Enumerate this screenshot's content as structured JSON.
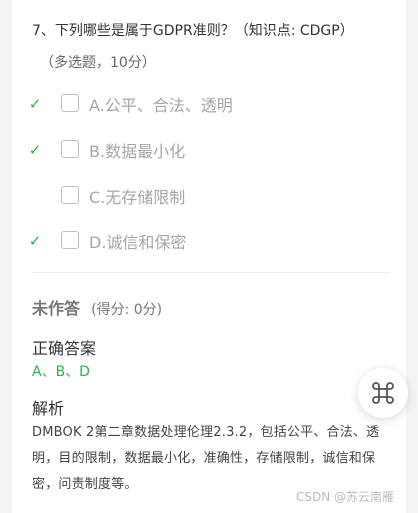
{
  "question": {
    "title": "7、下列哪些是属于GDPR准则？（知识点: CDGP）",
    "subtitle": "（多选题，10分）",
    "options": [
      {
        "label": "A.公平、合法、透明",
        "correct": true
      },
      {
        "label": "B.数据最小化",
        "correct": true
      },
      {
        "label": "C.无存储限制",
        "correct": false
      },
      {
        "label": "D.诚信和保密",
        "correct": true
      }
    ]
  },
  "result": {
    "status": "未作答",
    "score": "(得分: 0分)"
  },
  "answer": {
    "heading": "正确答案",
    "value": "A、B、D"
  },
  "analysis": {
    "heading": "解析",
    "text": "DMBOK 2第二章数据处理伦理2.3.2，包括公平、合法、透明，目的限制，数据最小化，准确性，存储限制，诚信和保密，问责制度等。"
  },
  "fab": {
    "icon": "command-icon"
  },
  "watermark": "CSDN @苏云南雁",
  "colors": {
    "accent": "#2bb24c",
    "muted": "#a6a6a6",
    "background": "#f4f4f4"
  }
}
